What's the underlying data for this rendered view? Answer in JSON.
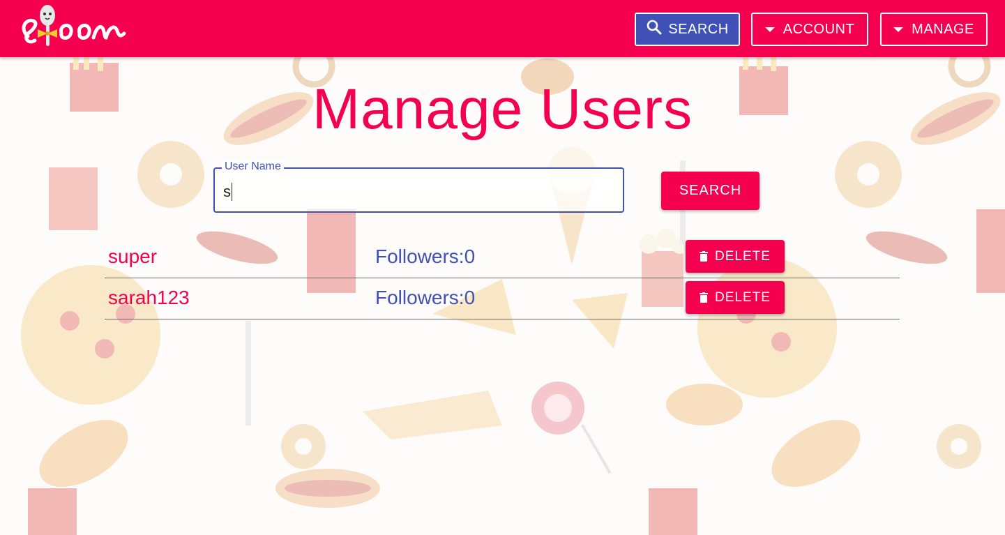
{
  "header": {
    "logo_text": "spoon",
    "search_label": "SEARCH",
    "account_label": "ACCOUNT",
    "manage_label": "MANAGE"
  },
  "main": {
    "title": "Manage Users",
    "search_field": {
      "label": "User Name",
      "value": "s"
    },
    "search_button_label": "SEARCH",
    "users": [
      {
        "name": "super",
        "followers": "Followers:0",
        "delete_label": "DELETE"
      },
      {
        "name": "sarah123",
        "followers": "Followers:0",
        "delete_label": "DELETE"
      }
    ]
  },
  "colors": {
    "primary": "#f5004f",
    "secondary": "#3f51b5"
  }
}
